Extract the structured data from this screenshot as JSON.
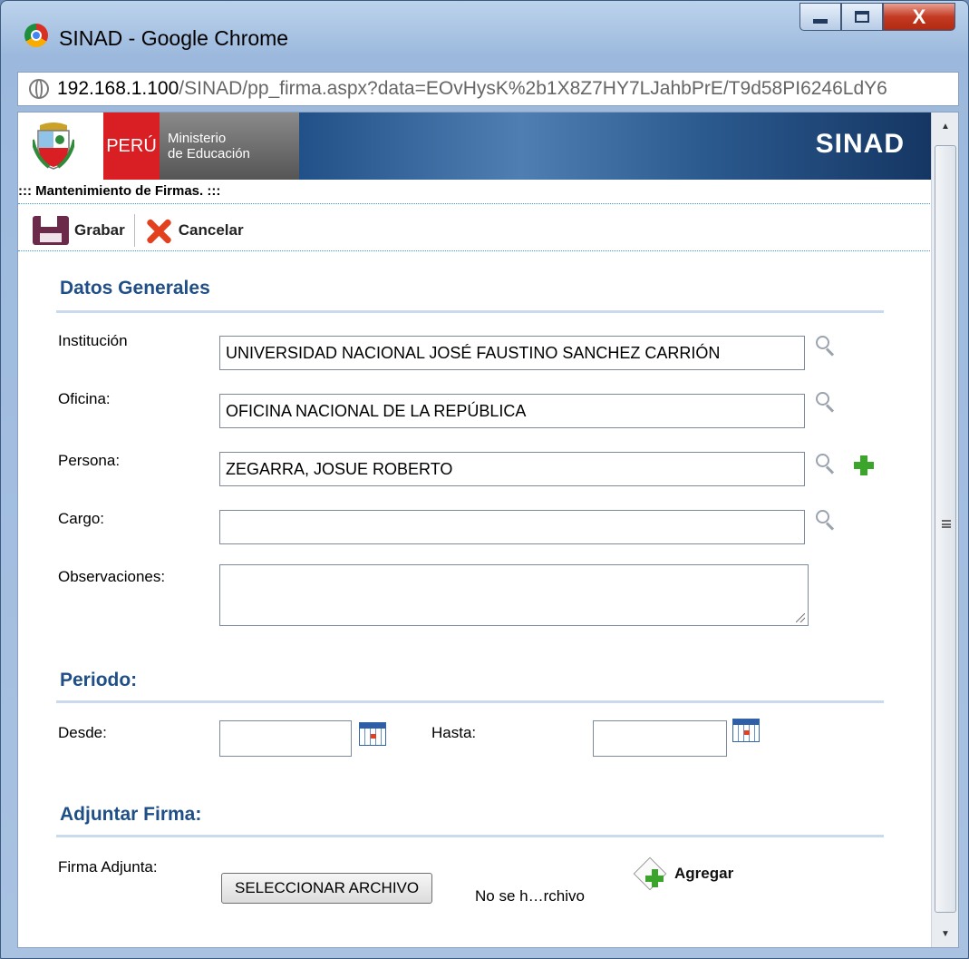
{
  "window": {
    "title": "SINAD - Google Chrome",
    "close_label": "X"
  },
  "address": {
    "host": "192.168.1.100",
    "path": "/SINAD/pp_firma.aspx?data=EOvHysK%2b1X8Z7HY7LJahbPrE/T9d58PI6246LdY6"
  },
  "banner": {
    "country": "PERÚ",
    "ministry_line1": "Ministerio",
    "ministry_line2": "de Educación",
    "app_name": "SINAD"
  },
  "page": {
    "caption": "::: Mantenimiento de Firmas. :::"
  },
  "toolbar": {
    "save_label": "Grabar",
    "cancel_label": "Cancelar"
  },
  "general": {
    "title": "Datos Generales",
    "institucion_label": "Institución",
    "institucion_value": "UNIVERSIDAD NACIONAL JOSÉ FAUSTINO SANCHEZ CARRIÓN",
    "oficina_label": "Oficina:",
    "oficina_value": "OFICINA NACIONAL DE LA REPÚBLICA",
    "persona_label": "Persona:",
    "persona_value": "ZEGARRA, JOSUE ROBERTO",
    "cargo_label": "Cargo:",
    "cargo_value": "",
    "observaciones_label": "Observaciones:",
    "observaciones_value": ""
  },
  "periodo": {
    "title": "Periodo:",
    "desde_label": "Desde:",
    "desde_value": "",
    "hasta_label": "Hasta:",
    "hasta_value": ""
  },
  "adjuntar": {
    "title": "Adjuntar Firma:",
    "firma_label": "Firma Adjunta:",
    "file_button": "SELECCIONAR ARCHIVO",
    "file_status": "No se h…rchivo",
    "add_label": "Agregar"
  }
}
